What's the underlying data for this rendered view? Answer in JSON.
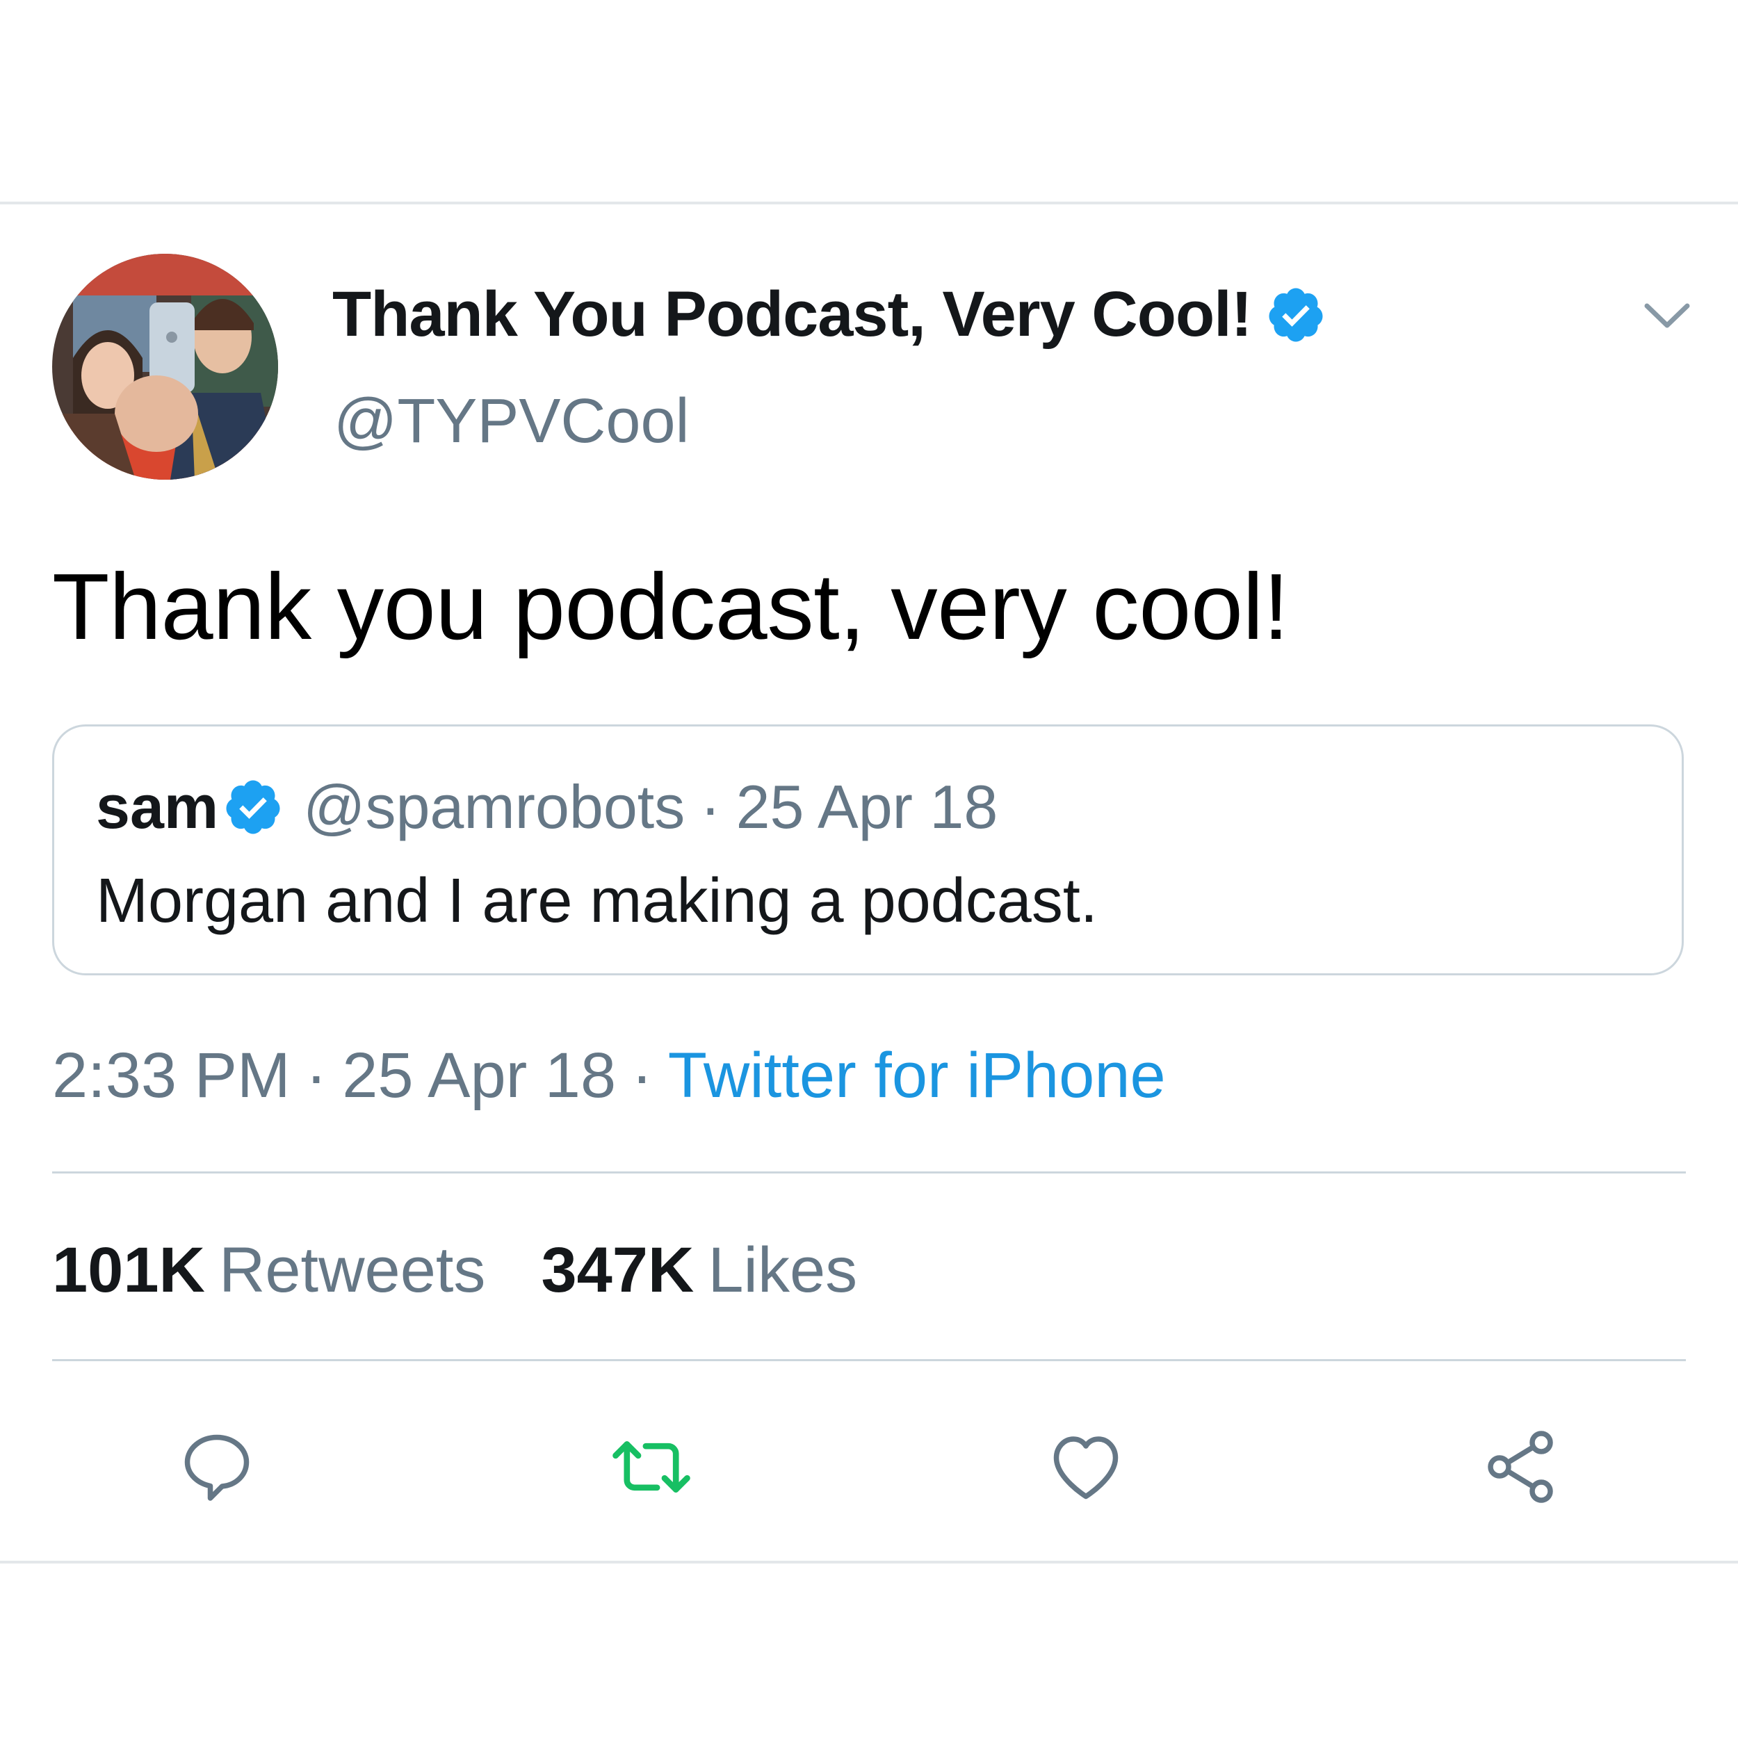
{
  "tweet": {
    "display_name": "Thank You Podcast, Very Cool!",
    "handle": "@TYPVCool",
    "text": "Thank you podcast, very cool!",
    "verified": true,
    "quoted": {
      "name": "sam",
      "handle": "@spamrobots",
      "separator": "·",
      "date": "25 Apr 18",
      "text": "Morgan and I are making a podcast."
    },
    "meta": {
      "time": "2:33 PM",
      "separator": "·",
      "date": "25 Apr 18",
      "source": "Twitter for iPhone"
    },
    "stats": {
      "retweets_count": "101K",
      "retweets_label": "Retweets",
      "likes_count": "347K",
      "likes_label": "Likes"
    }
  },
  "icons": {
    "verified": "verified-badge-icon",
    "more": "chevron-down-icon",
    "reply": "reply-icon",
    "retweet": "retweet-icon",
    "like": "heart-icon",
    "share": "share-icon"
  },
  "colors": {
    "verified_blue": "#1da1f2",
    "link_blue": "#1b95e0",
    "retweet_green": "#17bf63",
    "secondary_text": "#657786",
    "divider": "#ccd6dd"
  }
}
